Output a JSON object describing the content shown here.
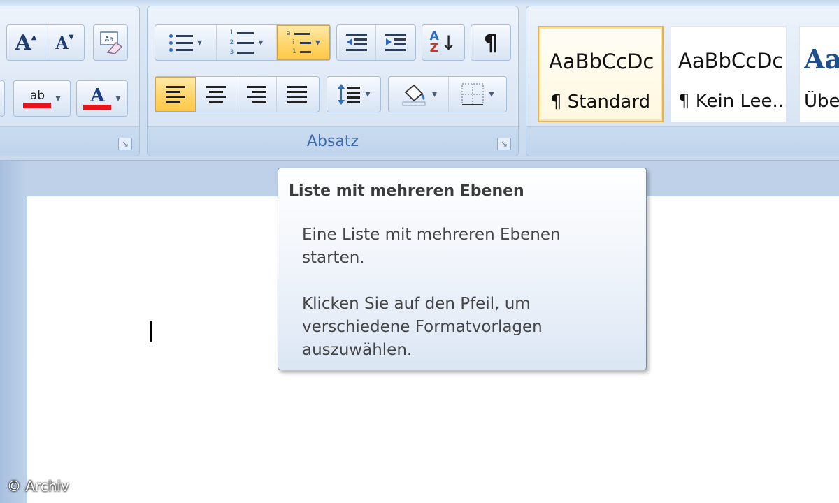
{
  "ribbon": {
    "font_group": {
      "buttons": {
        "grow_font": "A",
        "shrink_font": "A",
        "clear_format": "Aa",
        "highlight": "ab",
        "font_color": "A"
      }
    },
    "paragraph_group": {
      "label": "Absatz",
      "sort_glyph_top": "A",
      "sort_glyph_bottom": "Z",
      "pilcrow": "¶"
    },
    "styles": [
      {
        "sample": "AaBbCcDc",
        "name": "¶ Standard",
        "selected": true
      },
      {
        "sample": "AaBbCcDc",
        "name": "¶ Kein Lee..."
      },
      {
        "sample": "Aa",
        "name": "Übe"
      }
    ],
    "colors": {
      "highlight_bar": "#e8141c",
      "font_color_bar": "#e8141c",
      "active_button": "#ffd569",
      "group_label": "#3e6aaa"
    }
  },
  "tooltip": {
    "title": "Liste mit mehreren Ebenen",
    "p1_line1": "Eine Liste mit mehreren Ebenen",
    "p1_line2": "starten.",
    "p2_line1": "Klicken Sie auf den Pfeil, um",
    "p2_line2": "verschiedene Formatvorlagen",
    "p2_line3": "auszuwählen."
  },
  "watermark": "© Archiv"
}
